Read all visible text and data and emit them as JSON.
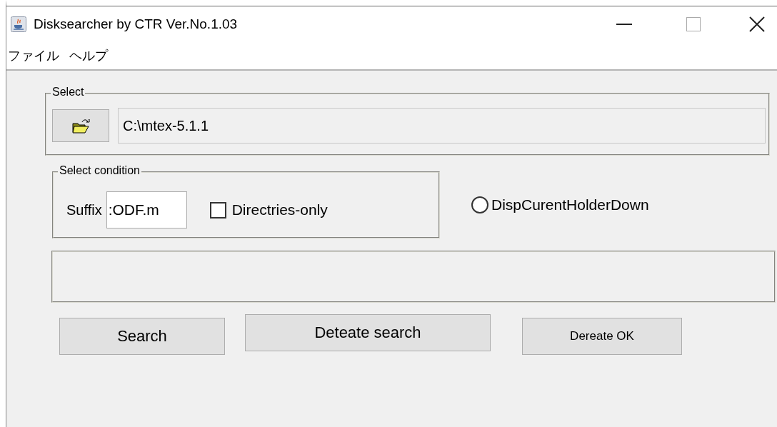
{
  "window": {
    "title": "Disksearcher by CTR Ver.No.1.03"
  },
  "menu": [
    {
      "label": "ファイル"
    },
    {
      "label": "ヘルプ"
    }
  ],
  "select_group": {
    "legend": "Select",
    "path": "C:\\mtex-5.1.1"
  },
  "condition_group": {
    "legend": "Select condition",
    "suffix_label": "Suffix",
    "suffix_value": ":ODF.m",
    "directories_only": {
      "label": "Directries-only",
      "checked": false
    }
  },
  "radio": {
    "label": "DispCurentHolderDown",
    "selected": false
  },
  "buttons": [
    {
      "label": "Search",
      "kind": "large"
    },
    {
      "label": "Deteate search",
      "kind": "large"
    },
    {
      "label": "Dereate OK",
      "kind": "small"
    }
  ]
}
